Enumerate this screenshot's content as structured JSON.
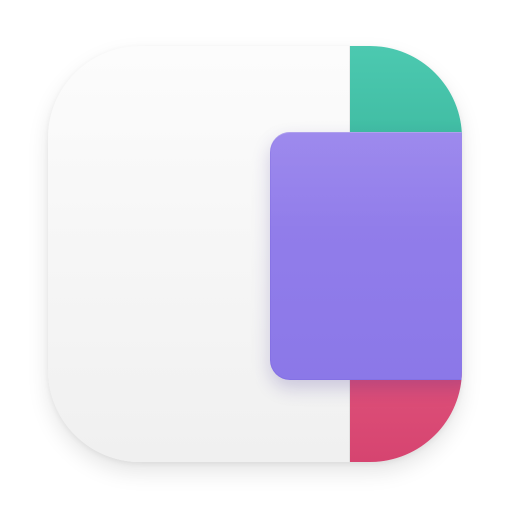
{
  "app_icon": {
    "colors": {
      "base": "#f4f4f4",
      "teal": "#46c2a8",
      "purple": "#8f7cea",
      "pink": "#dc4c76"
    },
    "icon_name": "app-icon"
  }
}
